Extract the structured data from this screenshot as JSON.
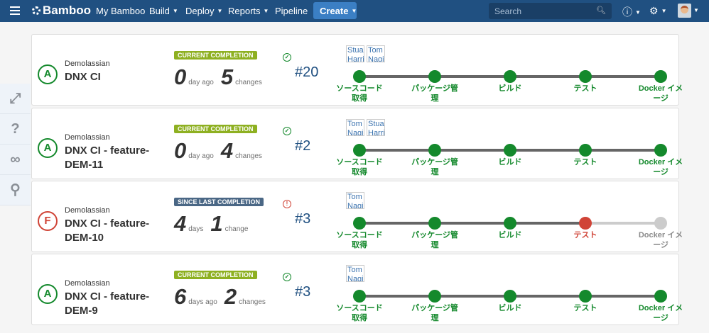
{
  "header": {
    "logo": "Bamboo",
    "nav": [
      {
        "label": "My Bamboo",
        "caret": false
      },
      {
        "label": "Build",
        "caret": true
      },
      {
        "label": "Deploy",
        "caret": true
      },
      {
        "label": "Reports",
        "caret": true
      },
      {
        "label": "Pipeline",
        "caret": false
      }
    ],
    "create": "Create",
    "search_placeholder": "Search"
  },
  "sidebar": [
    {
      "icon": "expand-icon",
      "glyph": "⤢"
    },
    {
      "icon": "help-icon",
      "glyph": "?"
    },
    {
      "icon": "link-icon",
      "glyph": "∞"
    },
    {
      "icon": "search-icon",
      "glyph": "⚲"
    }
  ],
  "colors": {
    "success": "#14892c",
    "failed": "#d04437",
    "header": "#205081"
  },
  "builds": [
    {
      "status": "A",
      "project": "Demolassian",
      "plan": "DNX CI",
      "badge": "CURRENT COMPLETION",
      "badge_type": "green",
      "n1": "0",
      "u1": "day ago",
      "n2": "5",
      "u2": "changes",
      "result": "success",
      "number": "#20",
      "authors": [
        "Stua Harri",
        "Tom Nagi"
      ],
      "stages": [
        {
          "name": "ソースコード取得",
          "state": "success"
        },
        {
          "name": "パッケージ管理",
          "state": "success"
        },
        {
          "name": "ビルド",
          "state": "success"
        },
        {
          "name": "テスト",
          "state": "success"
        },
        {
          "name": "Docker イメージ",
          "state": "success"
        }
      ]
    },
    {
      "status": "A",
      "project": "Demolassian",
      "plan": "DNX CI - feature-DEM-11",
      "badge": "CURRENT COMPLETION",
      "badge_type": "green",
      "n1": "0",
      "u1": "day ago",
      "n2": "4",
      "u2": "changes",
      "result": "success",
      "number": "#2",
      "authors": [
        "Tom Nagi",
        "Stua Harri"
      ],
      "stages": [
        {
          "name": "ソースコード取得",
          "state": "success"
        },
        {
          "name": "パッケージ管理",
          "state": "success"
        },
        {
          "name": "ビルド",
          "state": "success"
        },
        {
          "name": "テスト",
          "state": "success"
        },
        {
          "name": "Docker イメージ",
          "state": "success"
        }
      ]
    },
    {
      "status": "F",
      "project": "Demolassian",
      "plan": "DNX CI - feature-DEM-10",
      "badge": "SINCE LAST COMPLETION",
      "badge_type": "blue",
      "n1": "4",
      "u1": "days",
      "n2": "1",
      "u2": "change",
      "result": "failed",
      "number": "#3",
      "authors": [
        "Tom Nagi"
      ],
      "stages": [
        {
          "name": "ソースコード取得",
          "state": "success"
        },
        {
          "name": "パッケージ管理",
          "state": "success"
        },
        {
          "name": "ビルド",
          "state": "success"
        },
        {
          "name": "テスト",
          "state": "failed"
        },
        {
          "name": "Docker イメージ",
          "state": "pending"
        }
      ]
    },
    {
      "status": "A",
      "project": "Demolassian",
      "plan": "DNX CI - feature-DEM-9",
      "badge": "CURRENT COMPLETION",
      "badge_type": "green",
      "n1": "6",
      "u1": "days ago",
      "n2": "2",
      "u2": "changes",
      "result": "success",
      "number": "#3",
      "authors": [
        "Tom Nagi"
      ],
      "stages": [
        {
          "name": "ソースコード取得",
          "state": "success"
        },
        {
          "name": "パッケージ管理",
          "state": "success"
        },
        {
          "name": "ビルド",
          "state": "success"
        },
        {
          "name": "テスト",
          "state": "success"
        },
        {
          "name": "Docker イメージ",
          "state": "success"
        }
      ]
    }
  ]
}
